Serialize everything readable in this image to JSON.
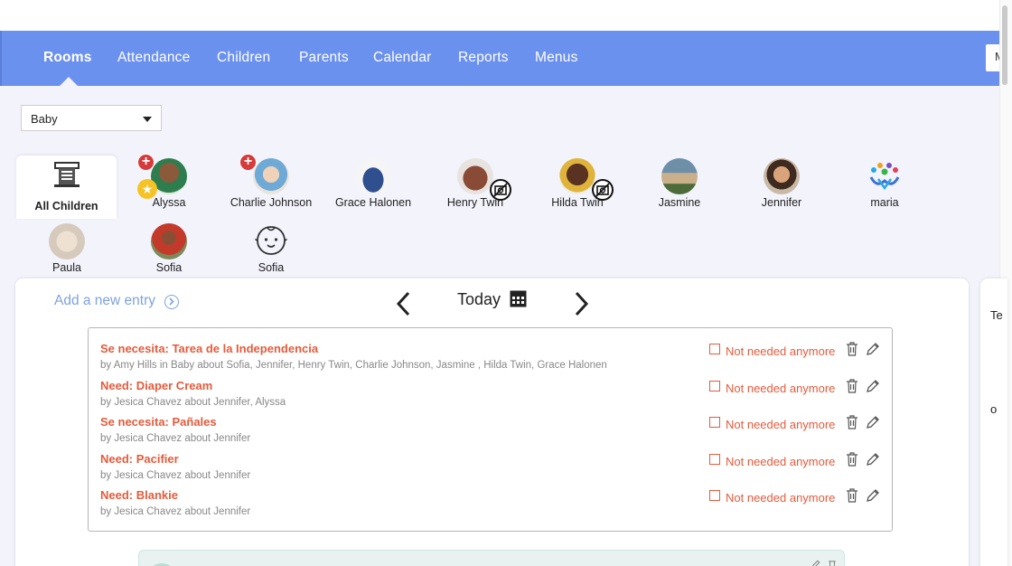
{
  "nav": {
    "items": [
      {
        "label": "Rooms",
        "active": true
      },
      {
        "label": "Attendance"
      },
      {
        "label": "Children"
      },
      {
        "label": "Parents"
      },
      {
        "label": "Calendar"
      },
      {
        "label": "Reports"
      },
      {
        "label": "Menus"
      }
    ],
    "right_box_label": "M"
  },
  "room_select": {
    "value": "Baby"
  },
  "all_children_label": "All Children",
  "children": [
    {
      "name": "Alyssa"
    },
    {
      "name": "Charlie Johnson"
    },
    {
      "name": "Grace Halonen"
    },
    {
      "name": "Henry Twin"
    },
    {
      "name": "Hilda Twin"
    },
    {
      "name": "Jasmine"
    },
    {
      "name": "Jennifer"
    },
    {
      "name": "maria"
    },
    {
      "name": "Paula"
    },
    {
      "name": "Sofia"
    },
    {
      "name": "Sofia"
    }
  ],
  "feed": {
    "add_entry_label": "Add a new entry",
    "date_label": "Today"
  },
  "notes": [
    {
      "title": "Se necesita: Tarea de la Independencia",
      "byline": "by Amy Hills in Baby about Sofia, Jennifer, Henry Twin, Charlie Johnson, Jasmine , Hilda Twin, Grace Halonen",
      "checkbox_label": "Not needed anymore"
    },
    {
      "title": "Need: Diaper Cream",
      "byline": "by Jesica Chavez about Jennifer, Alyssa",
      "checkbox_label": "Not needed anymore"
    },
    {
      "title": "Se necesita: Pañales",
      "byline": "by Jesica Chavez about Jennifer",
      "checkbox_label": "Not needed anymore"
    },
    {
      "title": "Need: Pacifier",
      "byline": "by Jesica Chavez about Jennifer",
      "checkbox_label": "Not needed anymore"
    },
    {
      "title": "Need: Blankie",
      "byline": "by Jesica Chavez about Jennifer",
      "checkbox_label": "Not needed anymore"
    }
  ],
  "side_panel": {
    "text1": "Te",
    "text2": "o"
  },
  "colors": {
    "nav_bg": "#6b91ef",
    "page_bg": "#f2f3fb",
    "note_title": "#e55b3c",
    "link": "#7fa2de"
  }
}
